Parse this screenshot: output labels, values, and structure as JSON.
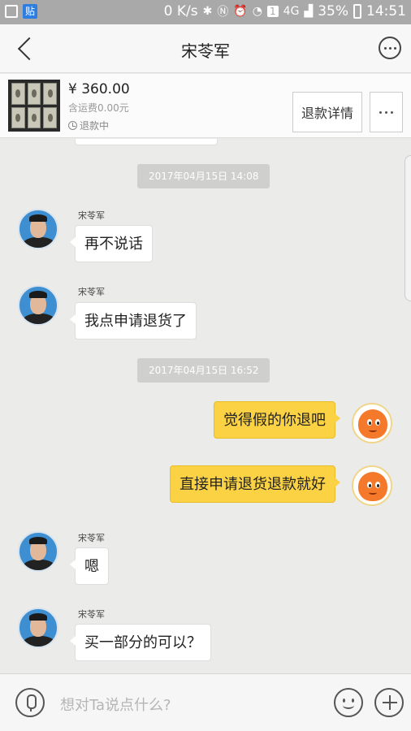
{
  "status_bar": {
    "app_badge": "贴",
    "speed": "0 K/s",
    "network": "4G",
    "sim_badge": "1",
    "battery": "35%",
    "time": "14:51"
  },
  "header": {
    "title": "宋苓军"
  },
  "product": {
    "price": "¥ 360.00",
    "shipping": "含运费0.00元",
    "status": "退款中",
    "refund_button": "退款详情"
  },
  "chat": {
    "timestamps": [
      "2017年04月15日 14:08",
      "2017年04月15日 16:52"
    ],
    "messages": [
      {
        "side": "in",
        "sender": "宋苓军",
        "text": "再不说话"
      },
      {
        "side": "in",
        "sender": "宋苓军",
        "text": "我点申请退货了"
      },
      {
        "side": "out",
        "text": "觉得假的你退吧"
      },
      {
        "side": "out",
        "text": "直接申请退货退款就好"
      },
      {
        "side": "in",
        "sender": "宋苓军",
        "text": "嗯"
      },
      {
        "side": "in",
        "sender": "宋苓军",
        "text": "买一部分的可以？"
      }
    ]
  },
  "input": {
    "placeholder": "想对Ta说点什么?"
  },
  "colors": {
    "outgoing_bubble": "#fcd245",
    "incoming_bubble": "#ffffff",
    "background": "#ebebe9"
  }
}
